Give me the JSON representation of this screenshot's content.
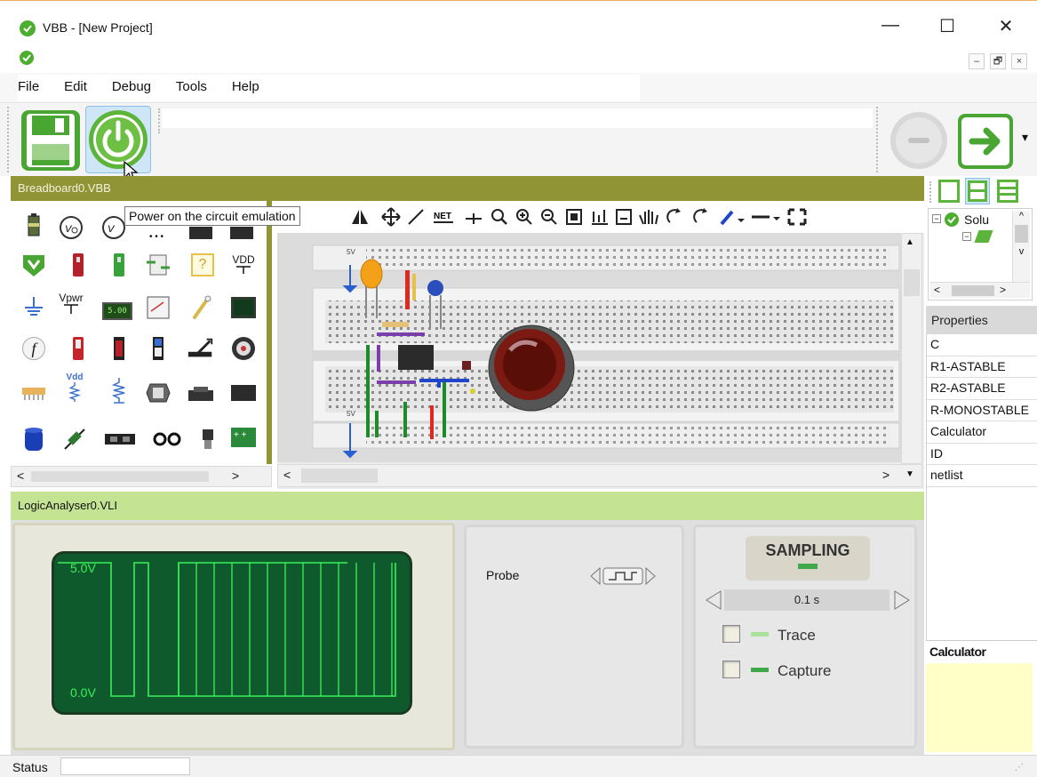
{
  "window": {
    "title": "VBB - [New Project]",
    "minimize_glyph": "—",
    "maximize_glyph": "☐",
    "close_glyph": "✕",
    "mdi_minimize_glyph": "–",
    "mdi_restore_glyph": "🗗",
    "mdi_close_glyph": "×"
  },
  "menu": {
    "items": [
      {
        "label": "File"
      },
      {
        "label": "Edit"
      },
      {
        "label": "Debug"
      },
      {
        "label": "Tools"
      },
      {
        "label": "Help"
      }
    ]
  },
  "toolbar": {
    "save_icon": "floppy-disk-icon",
    "power_icon": "power-icon",
    "stop_icon": "stop-circle-icon",
    "next_icon": "arrow-right-icon",
    "dropdown_glyph": "▾"
  },
  "tooltip": {
    "text": "Power on the circuit emulation"
  },
  "breadboard": {
    "header": "Breadboard0.VBB",
    "label_5v": "5V",
    "scroll_left": "<",
    "scroll_right": ">",
    "scroll_up": "▲",
    "scroll_down": "▼"
  },
  "palette": {
    "vdd_label": "VDD",
    "vpwr_label": "Vpwr",
    "lcd_value": "5.00",
    "f_label": "f",
    "help_label": "?",
    "vdd_small": "Vdd",
    "scroll_left": "<",
    "scroll_right": ">"
  },
  "logic_analyser": {
    "header": "LogicAnalyser0.VLI",
    "high_label": "5.0V",
    "low_label": "0.0V",
    "probe_label": "Probe",
    "sampling_title": "SAMPLING",
    "sampling_value": "0.1 s",
    "trace_label": "Trace",
    "capture_label": "Capture",
    "colors": {
      "screen": "#0e5a2c",
      "trace": "#3cf05a",
      "frame": "#e8e7dc"
    }
  },
  "right_panel": {
    "tree_root_label": "Solu",
    "properties_header": "Properties",
    "properties": [
      "C",
      "R1-ASTABLE",
      "R2-ASTABLE",
      "R-MONOSTABLE",
      "Calculator",
      "ID",
      "netlist"
    ],
    "calculator_header": "Calculator"
  },
  "status": {
    "label": "Status",
    "value": ""
  },
  "colors": {
    "olive_header": "#909434",
    "green_header": "#c4e493",
    "brand_green": "#4cae2f"
  }
}
